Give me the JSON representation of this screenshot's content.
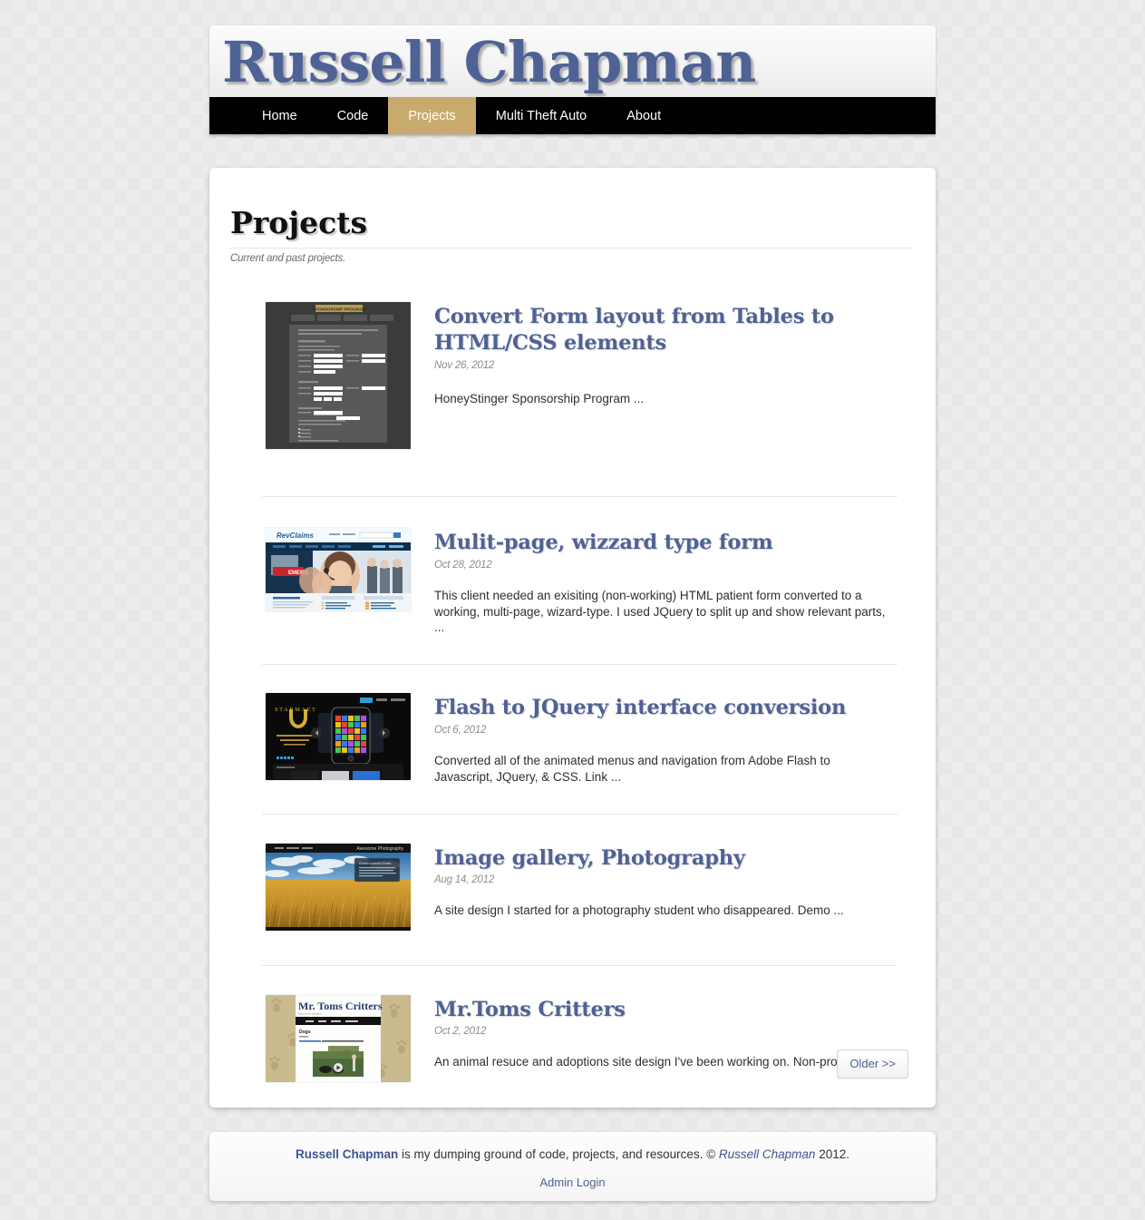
{
  "site": {
    "title": "Russell Chapman",
    "title_color": "#4f6296"
  },
  "nav": {
    "items": [
      {
        "label": "Home",
        "active": false
      },
      {
        "label": "Code",
        "active": false
      },
      {
        "label": "Projects",
        "active": true
      },
      {
        "label": "Multi Theft Auto",
        "active": false
      },
      {
        "label": "About",
        "active": false
      }
    ],
    "active_color": "#c9aa6d",
    "bar_color": "#000000"
  },
  "page": {
    "heading": "Projects",
    "subtitle": "Current and past projects."
  },
  "entries": [
    {
      "title": "Convert Form layout from Tables to HTML/CSS elements",
      "date": "Nov 26, 2012",
      "excerpt": "HoneyStinger Sponsorship Program ...",
      "thumb_name": "thumb-sponsorship-form"
    },
    {
      "title": "Mulit-page, wizzard type form",
      "date": "Oct 28, 2012",
      "excerpt": "This client needed an exisiting (non-working) HTML patient form converted to a working, multi-page, wizard-type. I used JQuery to split up and show relevant parts, ...",
      "thumb_name": "thumb-medical-site"
    },
    {
      "title": "Flash to JQuery interface conversion",
      "date": "Oct 6, 2012",
      "excerpt": "Converted all of the animated menus and navigation from Adobe Flash to Javascript, JQuery, & CSS. Link ...",
      "thumb_name": "thumb-mobile-game-site"
    },
    {
      "title": "Image gallery, Photography",
      "date": "Aug 14, 2012",
      "excerpt": "A site design I started for a photography student who disappeared. Demo ...",
      "thumb_name": "thumb-photography-site"
    },
    {
      "title": "Mr.Toms Critters",
      "date": "Oct 2, 2012",
      "excerpt": "An animal resuce and adoptions site design I've been working on. Non-profit Link ...",
      "thumb_name": "thumb-critters-site"
    }
  ],
  "pager": {
    "older_label": "Older >>"
  },
  "footer": {
    "name": "Russell Chapman",
    "text_middle": " is my dumping ground of code, projects, and resources. © ",
    "copyright_name": "Russell Chapman",
    "year": " 2012.",
    "admin_label": "Admin Login"
  }
}
